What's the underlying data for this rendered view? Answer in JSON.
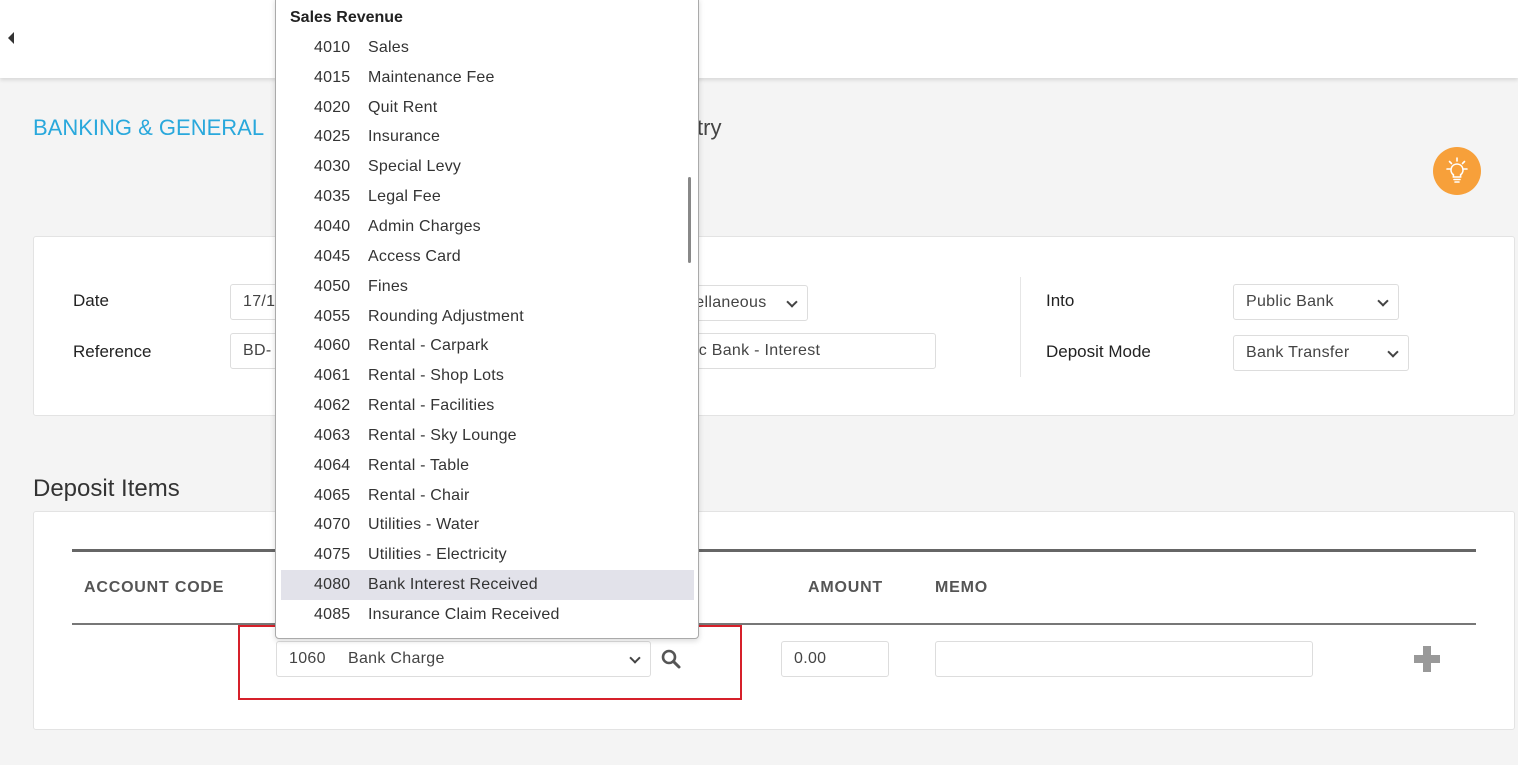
{
  "page": {
    "module": "BANKING & GENERAL",
    "title_tail": "try"
  },
  "header_form": {
    "date_label": "Date",
    "date_value": "17/1",
    "reference_label": "Reference",
    "reference_value": "BD-",
    "category_value": "cellaneous",
    "description_value": "lic Bank - Interest",
    "into_label": "Into",
    "into_value": "Public Bank",
    "deposit_mode_label": "Deposit Mode",
    "deposit_mode_value": "Bank Transfer"
  },
  "deposit_items": {
    "section_title": "Deposit Items",
    "columns": {
      "account_code": "ACCOUNT CODE",
      "amount": "AMOUNT",
      "memo": "MEMO"
    },
    "row": {
      "account_code": "1060",
      "account_name": "Bank Charge",
      "amount": "0.00",
      "memo": ""
    }
  },
  "dropdown": {
    "group_label": "Sales Revenue",
    "highlighted_code": "4080",
    "options": [
      {
        "code": "4010",
        "name": "Sales"
      },
      {
        "code": "4015",
        "name": "Maintenance Fee"
      },
      {
        "code": "4020",
        "name": "Quit Rent"
      },
      {
        "code": "4025",
        "name": "Insurance"
      },
      {
        "code": "4030",
        "name": "Special Levy"
      },
      {
        "code": "4035",
        "name": "Legal Fee"
      },
      {
        "code": "4040",
        "name": "Admin Charges"
      },
      {
        "code": "4045",
        "name": "Access Card"
      },
      {
        "code": "4050",
        "name": "Fines"
      },
      {
        "code": "4055",
        "name": "Rounding Adjustment"
      },
      {
        "code": "4060",
        "name": "Rental - Carpark"
      },
      {
        "code": "4061",
        "name": "Rental - Shop Lots"
      },
      {
        "code": "4062",
        "name": "Rental - Facilities"
      },
      {
        "code": "4063",
        "name": "Rental - Sky Lounge"
      },
      {
        "code": "4064",
        "name": "Rental - Table"
      },
      {
        "code": "4065",
        "name": "Rental - Chair"
      },
      {
        "code": "4070",
        "name": "Utilities - Water"
      },
      {
        "code": "4075",
        "name": "Utilities - Electricity"
      },
      {
        "code": "4080",
        "name": "Bank Interest Received"
      },
      {
        "code": "4085",
        "name": "Insurance Claim Received"
      }
    ]
  },
  "colors": {
    "module_title": "#29a8dc",
    "help_button": "#f7a03a",
    "highlight_box": "#d6202a",
    "option_highlight": "#e2e2ea"
  },
  "icons": {
    "back": "caret-left-icon",
    "help": "lightbulb-icon",
    "search": "search-icon",
    "add": "plus-icon"
  }
}
